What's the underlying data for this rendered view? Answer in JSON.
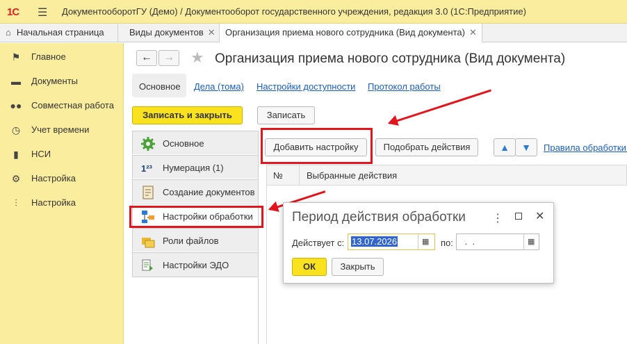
{
  "titlebar": {
    "logo": "1С",
    "title": "ДокументооборотГУ (Демо) / Документооборот государственного учреждения, редакция 3.0  (1С:Предприятие)"
  },
  "tabs": [
    {
      "label": "Начальная страница"
    },
    {
      "label": "Виды документов"
    },
    {
      "label": "Организация приема нового сотрудника (Вид документа)"
    }
  ],
  "sidebar": {
    "items": [
      {
        "label": "Главное",
        "icon": "flag-icon"
      },
      {
        "label": "Документы",
        "icon": "folder-icon"
      },
      {
        "label": "Совместная работа",
        "icon": "people-icon"
      },
      {
        "label": "Учет времени",
        "icon": "clock-icon"
      },
      {
        "label": "НСИ",
        "icon": "book-icon"
      },
      {
        "label": "Настройка",
        "icon": "gear-icon"
      },
      {
        "label": "Настройка",
        "icon": "sliders-icon"
      }
    ]
  },
  "main": {
    "title": "Организация приема нового сотрудника (Вид документа)",
    "form_tabs": [
      "Основное",
      "Дела (тома)",
      "Настройки доступности",
      "Протокол работы"
    ],
    "save_close": "Записать и закрыть",
    "save": "Записать",
    "sections": [
      {
        "label": "Основное",
        "icon": "gear-icon"
      },
      {
        "label": "Нумерация (1)",
        "icon": "numbering-icon"
      },
      {
        "label": "Создание документов",
        "icon": "document-icon"
      },
      {
        "label": "Настройки обработки",
        "icon": "flowchart-icon"
      },
      {
        "label": "Роли файлов",
        "icon": "folders-icon"
      },
      {
        "label": "Настройки ЭДО",
        "icon": "edo-icon"
      }
    ],
    "add_setting": "Добавить настройку",
    "pick_actions": "Подобрать действия",
    "rules_link": "Правила обработки д",
    "table": {
      "col_num": "№",
      "col_actions": "Выбранные действия"
    }
  },
  "dialog": {
    "title": "Период действия обработки",
    "from_label": "Действует с:",
    "from_value": "13.07.2026",
    "to_label": "по:",
    "to_value": " .  .",
    "ok": "ОК",
    "close": "Закрыть"
  }
}
